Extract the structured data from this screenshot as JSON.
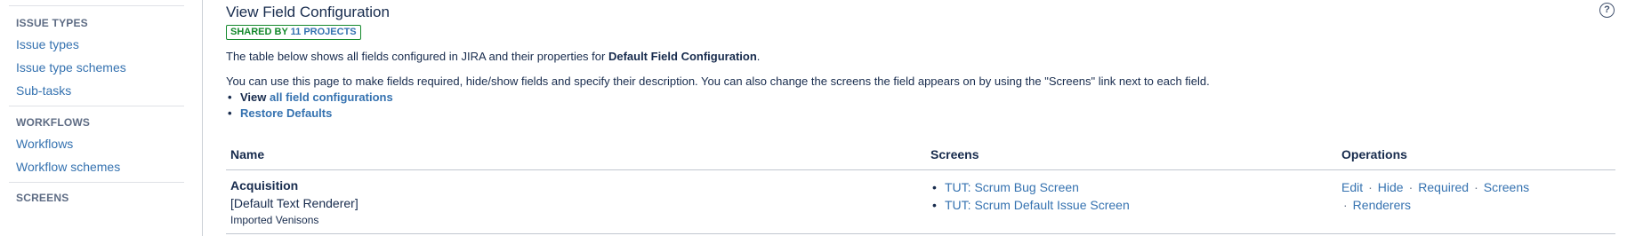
{
  "sidebar": {
    "sections": [
      {
        "heading": "ISSUE TYPES",
        "items": [
          "Issue types",
          "Issue type schemes",
          "Sub-tasks"
        ]
      },
      {
        "heading": "WORKFLOWS",
        "items": [
          "Workflows",
          "Workflow schemes"
        ]
      },
      {
        "heading": "SCREENS",
        "items": []
      }
    ]
  },
  "header": {
    "title": "View Field Configuration",
    "help_icon": "question-mark-icon",
    "shared_prefix": "SHARED BY",
    "shared_count": "11 PROJECTS"
  },
  "description": {
    "line1_pre": "The table below shows all fields configured in JIRA and their properties for ",
    "line1_bold": "Default Field Configuration",
    "line1_post": ".",
    "line2": "You can use this page to make fields required, hide/show fields and specify their description. You can also change the screens the field appears on by using the \"Screens\" link next to each field.",
    "bullet1_prefix": "View",
    "bullet1_link": "all field configurations",
    "bullet2_link": "Restore Defaults"
  },
  "table": {
    "columns": [
      "Name",
      "Screens",
      "Operations"
    ],
    "rows": [
      {
        "name": "Acquisition",
        "renderer": "[Default Text Renderer]",
        "description": "Imported Venisons",
        "screens": [
          "TUT: Scrum Bug Screen",
          "TUT: Scrum Default Issue Screen"
        ],
        "operations": [
          "Edit",
          "Hide",
          "Required",
          "Screens",
          "Renderers"
        ],
        "separator": "·"
      }
    ]
  },
  "colors": {
    "link": "#3572b0",
    "text": "#172b4d",
    "badge_green": "#14892c",
    "heading_grey": "#5e6c84"
  }
}
